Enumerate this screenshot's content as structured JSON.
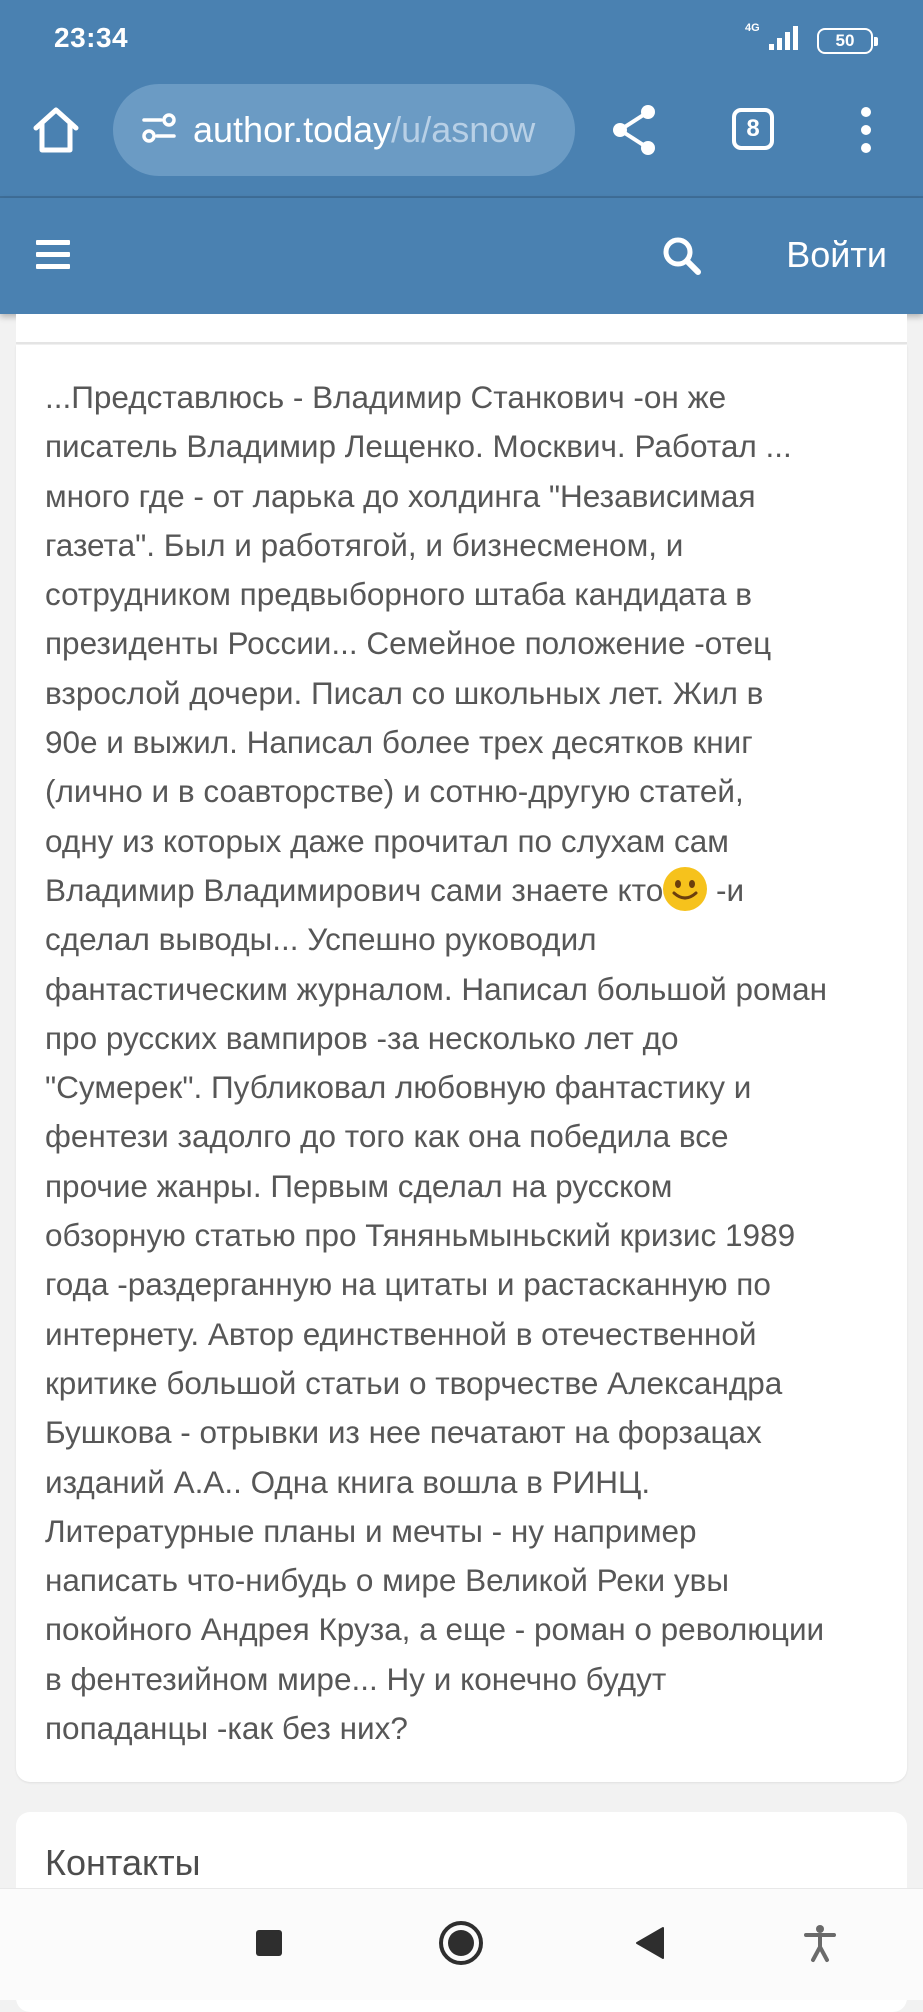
{
  "status_bar": {
    "time": "23:34",
    "network": "4G",
    "battery": "50"
  },
  "browser": {
    "url_host": "author.today",
    "url_path": "/u/asnow",
    "tab_count": "8",
    "icons": [
      "home-icon",
      "site-settings-icon",
      "share-icon",
      "tabs-icon",
      "more-vert-icon"
    ]
  },
  "site_header": {
    "login_label": "Войти",
    "icons": [
      "hamburger-icon",
      "search-icon"
    ]
  },
  "bio": {
    "part1": "...Представлюсь - Владимир Станкович -он же\nписатель Владимир Лещенко. Москвич.  Работал ...\nмного где - от ларька до холдинга  \"Независимая\nгазета\". Был и работягой, и бизнесменом, и\nсотрудником предвыборного штаба  кандидата в\nпрезиденты России... Семейное положение -отец\nвзрослой  дочери.  Писал со школьных лет. Жил в\n90е и выжил. Написал более трех десятков книг\n(лично и в соавторстве)  и сотню-другую  статей,\nодну из которых даже прочитал по слухам сам\nВладимир Владимирович сами знаете кто",
    "emoji": "smile-emoji",
    "part2": "  -и\nсделал выводы...    Успешно руководил\nфантастическим журналом. Написал большой роман\nпро русских вампиров -за несколько лет до\n\"Сумерек\". Публиковал любовную фантастику и\nфентези задолго до того как она победила все\nпрочие жанры.  Первым сделал на русском\nобзорную статью про Тяняньмыньский кризис 1989\nгода -раздерганную на цитаты и  растасканную по\nинтернету. Автор  единственной в отечественной\nкритике большой статьи о творчестве Александра\nБушкова - отрывки из нее печатают на форзацах\nизданий А.А.. Одна книга вошла  в РИНЦ.\nЛитературные планы и мечты - ну например\nнаписать что-нибудь о мире Великой Реки увы\nпокойного Андрея Круза, а еще -  роман о революции\nв фентезийном мире... Ну и конечно будут\nпопаданцы -как без них?"
  },
  "contacts": {
    "title": "Контакты"
  },
  "nav_bar": {
    "icons": [
      "recents-square-icon",
      "home-circle-icon",
      "back-triangle-icon",
      "accessibility-icon"
    ]
  },
  "colors": {
    "header_blue": "#4a81b1",
    "url_box": "#6b9bc4",
    "text_gray": "#575757"
  }
}
